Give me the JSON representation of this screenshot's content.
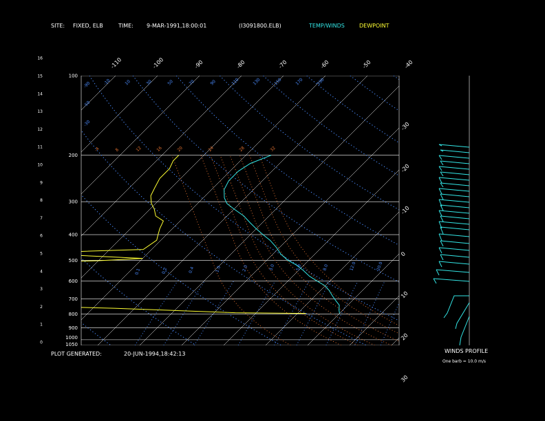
{
  "header": {
    "site_label": "SITE:",
    "site_value": "FIXED, ELB",
    "time_label": "TIME:",
    "time_value": "9-MAR-1991,18:00:01",
    "file": "(I3091800.ELB)",
    "legend_temp": "TEMP/WINDS",
    "legend_dew": "DEWPOINT"
  },
  "footer": {
    "plot_generated_label": "PLOT GENERATED:",
    "plot_generated_value": "20-JUN-1994,18:42:13",
    "winds_title": "WINDS PROFILE",
    "barb_note": "One barb = 10.0 m/s"
  },
  "colors": {
    "temp": "#33e6e6",
    "dewpoint": "#ffff33",
    "isotherm": "#ffffff",
    "dry_adiabat": "#4b8cff",
    "moist_adiabat": "#e07030",
    "mixing_ratio": "#4b8cff",
    "isobar": "#ffffff"
  },
  "chart_data": {
    "type": "line",
    "title": "",
    "xlabel": "",
    "ylabel": "",
    "pressure_axis_labels": [
      "100",
      "200",
      "300",
      "400",
      "500",
      "600",
      "700",
      "800",
      "900",
      "1000",
      "1050"
    ],
    "height_axis_labels": [
      "0",
      "1",
      "2",
      "3",
      "4",
      "5",
      "6",
      "7",
      "8",
      "9",
      "10",
      "11",
      "12",
      "13",
      "14",
      "15",
      "16"
    ],
    "isotherm_labels_top": [
      "-110",
      "-100",
      "-90",
      "-80",
      "-70",
      "-60",
      "-50",
      "-40"
    ],
    "isotherm_labels_right": [
      "-30",
      "-20",
      "-10",
      "0",
      "10",
      "20",
      "30"
    ],
    "dry_adiabat_labels": [
      "-90",
      "-50",
      "-30",
      "-10",
      "10",
      "30",
      "50",
      "70",
      "90",
      "110",
      "130",
      "150",
      "170",
      "190"
    ],
    "moist_adiabat_labels": [
      "-4",
      "8",
      "12",
      "16",
      "20",
      "24",
      "28",
      "32"
    ],
    "mixing_ratio_labels": [
      "0.1",
      "0.2",
      "0.4",
      "1.0",
      "2.0",
      "3.0",
      "5.0",
      "8.0",
      "12.0",
      "20.0"
    ],
    "series": [
      {
        "name": "TEMP/WINDS",
        "pressure_hPa": [
          200,
          205,
          215,
          230,
          250,
          270,
          290,
          305,
          320,
          340,
          360,
          380,
          400,
          420,
          445,
          475,
          500,
          520,
          545,
          575,
          600,
          625,
          650,
          680,
          710,
          740,
          770,
          795
        ],
        "temperature_C": [
          -54,
          -55,
          -57,
          -58,
          -58,
          -57,
          -55,
          -53,
          -50,
          -46,
          -43,
          -40,
          -37,
          -34,
          -31,
          -28,
          -25,
          -22,
          -19,
          -16,
          -13,
          -10,
          -8,
          -6,
          -4,
          -2,
          -1,
          0
        ]
      },
      {
        "name": "DEWPOINT",
        "pressure_hPa": [
          200,
          210,
          225,
          245,
          265,
          285,
          305,
          320,
          340,
          355,
          380,
          400,
          420,
          455,
          465,
          470,
          480,
          492,
          502,
          515,
          690,
          700,
          715,
          720,
          728,
          730,
          760,
          790,
          795
        ],
        "dewpoint_C": [
          -76,
          -76,
          -75,
          -75,
          -74,
          -73,
          -71,
          -69,
          -67,
          -64,
          -63,
          -62,
          -61,
          -62,
          -80,
          -100,
          -75,
          -60,
          -70,
          -100,
          -100,
          -80,
          -76,
          -70,
          -80,
          -100,
          -55,
          -25,
          -8
        ]
      }
    ],
    "xlim_C": [
      -110,
      -40
    ],
    "ylim_hPa": [
      100,
      1050
    ],
    "log_pressure": true,
    "grid": true,
    "legend": "top"
  }
}
